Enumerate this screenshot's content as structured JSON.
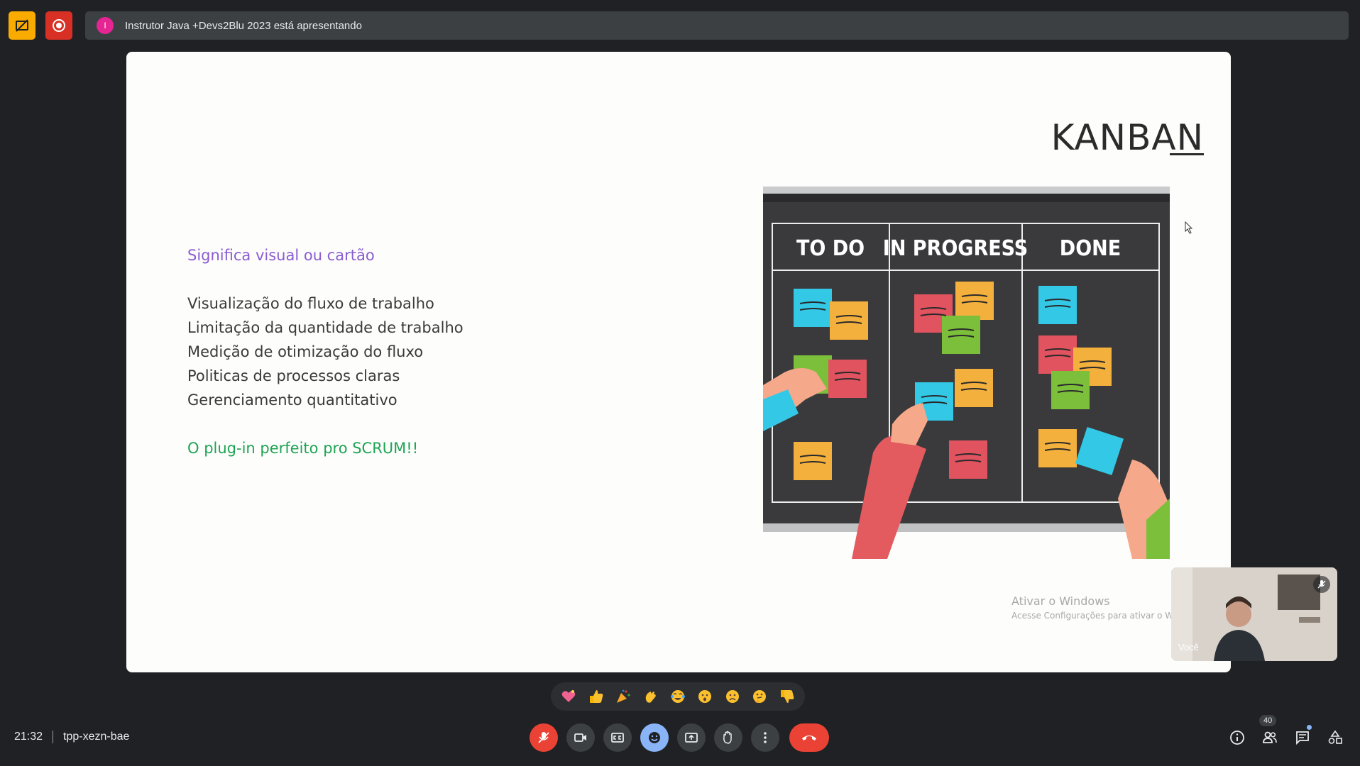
{
  "top_bar": {
    "presenter_initial": "I",
    "presenting_text": "Instrutor Java +Devs2Blu 2023 está apresentando"
  },
  "slide": {
    "title": "KANBAN",
    "subtitle": "Significa visual ou cartão",
    "bullets": [
      "Visualização do fluxo de trabalho",
      "Limitação da quantidade de trabalho",
      "Medição de otimização do fluxo",
      "Politicas de processos claras",
      "Gerenciamento quantitativo"
    ],
    "highlight": "O plug-in perfeito pro SCRUM!!",
    "board_columns": [
      "TO DO",
      "IN PROGRESS",
      "DONE"
    ],
    "watermark_title": "Ativar o Windows",
    "watermark_sub": "Acesse Configurações para ativar o Wind"
  },
  "self_view": {
    "name": "Você"
  },
  "reactions": [
    "sparkling-heart",
    "thumbs-up",
    "party-popper",
    "clapping-hands",
    "tears-of-joy",
    "surprised-face",
    "sad-face",
    "thinking-face",
    "thumbs-down"
  ],
  "bottom_bar": {
    "time": "21:32",
    "meeting_code": "tpp-xezn-bae",
    "participant_count": "40"
  },
  "colors": {
    "background": "#202124",
    "bar": "#3c4043",
    "danger": "#ea4335",
    "accent": "#8ab4f8",
    "slide_subtitle": "#8a5cd1",
    "slide_highlight": "#1ea454"
  }
}
